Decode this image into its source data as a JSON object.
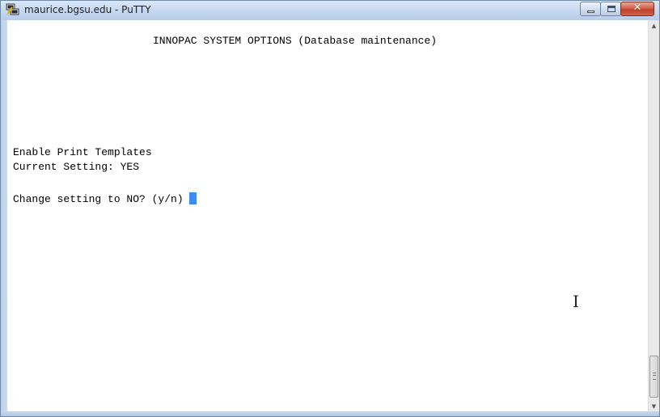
{
  "window": {
    "title": "maurice.bgsu.edu - PuTTY",
    "icon": "putty-icon"
  },
  "caption_buttons": {
    "minimize_icon": "minimize-icon",
    "maximize_icon": "maximize-icon",
    "close_label": "✕"
  },
  "terminal": {
    "header": "INNOPAC SYSTEM OPTIONS (Database maintenance)",
    "lines": [
      "Enable Print Templates",
      "Current Setting: YES",
      "Change setting to NO? (y/n) "
    ],
    "cursor_color": "#3b8cf5"
  },
  "scrollbar": {
    "up_arrow": "▲",
    "down_arrow": "▼"
  },
  "mouse_pointer": "I"
}
